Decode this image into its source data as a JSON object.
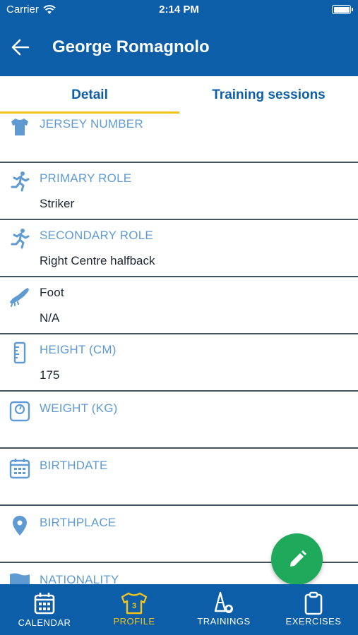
{
  "status_bar": {
    "carrier": "Carrier",
    "time": "2:14 PM"
  },
  "header": {
    "title": "George Romagnolo"
  },
  "tabs": [
    {
      "label": "Detail",
      "active": true
    },
    {
      "label": "Training sessions",
      "active": false
    }
  ],
  "fields": [
    {
      "label": "JERSEY NUMBER",
      "value": "",
      "icon": "jersey-icon"
    },
    {
      "label": "PRIMARY ROLE",
      "value": "Striker",
      "icon": "running-player-icon"
    },
    {
      "label": "SECONDARY ROLE",
      "value": "Right Centre halfback",
      "icon": "running-player-icon"
    },
    {
      "label": "Foot",
      "value": "N/A",
      "icon": "football-boot-icon"
    },
    {
      "label": "HEIGHT (CM)",
      "value": "175",
      "icon": "ruler-icon"
    },
    {
      "label": "WEIGHT (KG)",
      "value": "",
      "icon": "scale-icon"
    },
    {
      "label": "BIRTHDATE",
      "value": "",
      "icon": "calendar-icon"
    },
    {
      "label": "BIRTHPLACE",
      "value": "",
      "icon": "location-pin-icon"
    },
    {
      "label": "NATIONALITY",
      "value": "",
      "icon": "flag-icon"
    }
  ],
  "bottom_nav": [
    {
      "label": "CALENDAR",
      "icon": "calendar-icon",
      "active": false
    },
    {
      "label": "PROFILE",
      "icon": "jersey-icon",
      "active": true,
      "badge": "3"
    },
    {
      "label": "TRAININGS",
      "icon": "cone-ball-icon",
      "active": false
    },
    {
      "label": "EXERCISES",
      "icon": "clipboard-icon",
      "active": false
    }
  ],
  "fab": {
    "icon": "pencil-icon"
  },
  "colors": {
    "primary": "#0c5ea8",
    "accent": "#f2c31b",
    "fab": "#1faa5b",
    "label": "#5f9bd2",
    "divider": "#44535e"
  }
}
